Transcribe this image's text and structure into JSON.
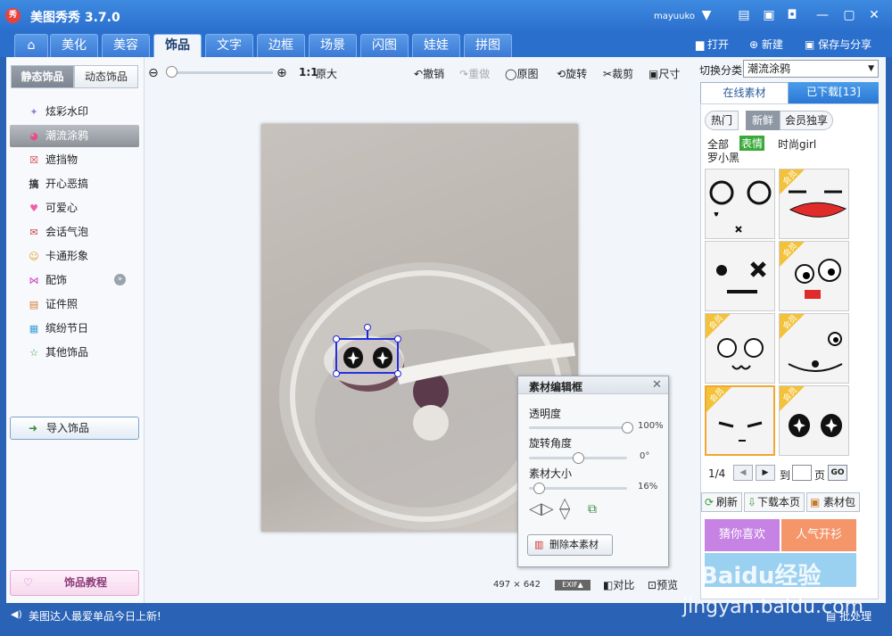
{
  "app": {
    "title": "美图秀秀 3.7.0",
    "logo_text": "秀",
    "user": "mayuuko"
  },
  "window_buttons": [
    "▼",
    "▤",
    "▣",
    "◘",
    "—",
    "▢",
    "✕"
  ],
  "tabs": [
    {
      "label": "⌂",
      "active": false
    },
    {
      "label": "美化",
      "active": false
    },
    {
      "label": "美容",
      "active": false
    },
    {
      "label": "饰品",
      "active": true
    },
    {
      "label": "文字",
      "active": false
    },
    {
      "label": "边框",
      "active": false
    },
    {
      "label": "场景",
      "active": false
    },
    {
      "label": "闪图",
      "active": false
    },
    {
      "label": "娃娃",
      "active": false
    },
    {
      "label": "拼图",
      "active": false
    }
  ],
  "top_actions": {
    "open": "打开",
    "new": "新建",
    "save_share": "保存与分享"
  },
  "left": {
    "tab_static": "静态饰品",
    "tab_dynamic": "动态饰品",
    "items": [
      {
        "label": "炫彩水印",
        "icon": "✦"
      },
      {
        "label": "潮流涂鸦",
        "icon": "◕"
      },
      {
        "label": "遮挡物",
        "icon": "☒"
      },
      {
        "label": "开心恶搞",
        "icon": "搞"
      },
      {
        "label": "可爱心",
        "icon": "♥"
      },
      {
        "label": "会话气泡",
        "icon": "✉"
      },
      {
        "label": "卡通形象",
        "icon": "☺"
      },
      {
        "label": "配饰",
        "icon": "⋈"
      },
      {
        "label": "证件照",
        "icon": "▤"
      },
      {
        "label": "缤纷节日",
        "icon": "▦"
      },
      {
        "label": "其他饰品",
        "icon": "☆"
      }
    ],
    "expand_icon": "»",
    "import_label": "导入饰品",
    "tutorial_label": "饰品教程"
  },
  "toolbar": {
    "zoom_ratio": "1:1",
    "original_size": "原大",
    "undo": "撤销",
    "redo": "重做",
    "original": "原图",
    "rotate": "旋转",
    "crop": "裁剪",
    "size": "尺寸"
  },
  "image_info": {
    "width": "497",
    "x": "×",
    "height": "642",
    "exif": "EXIF▲",
    "compare": "对比",
    "preview": "预览"
  },
  "dialog": {
    "title": "素材编辑框",
    "opacity_label": "透明度",
    "opacity_value": "100%",
    "opacity": 1.0,
    "rotation_label": "旋转角度",
    "rotation_value": "0°",
    "rotation": 0.5,
    "size_label": "素材大小",
    "size_value": "16%",
    "size": 0.1,
    "delete_label": "删除本素材"
  },
  "right": {
    "switch_label": "切换分类",
    "category": "潮流涂鸦",
    "tab_online": "在线素材",
    "tab_downloaded": "已下载[13]",
    "filters": [
      "热门",
      "新鲜",
      "会员独享"
    ],
    "subfilters": [
      "全部",
      "表情",
      "时尚girl",
      "罗小黑"
    ],
    "vip_label": "会员",
    "pagination": {
      "page": "1/4",
      "prev": "◀",
      "next": "▶",
      "to": "到",
      "page_unit": "页",
      "go": "GO"
    },
    "actions": {
      "refresh": "刷新",
      "download": "下载本页",
      "pack": "素材包"
    },
    "banners": [
      "猜你喜欢",
      "人气开衫"
    ]
  },
  "status": {
    "message": "美图达人最爱单品今日上新!",
    "batch": "批处理"
  },
  "watermark": {
    "brand": "Baidu经验",
    "url": "jingyan.baidu.com"
  }
}
